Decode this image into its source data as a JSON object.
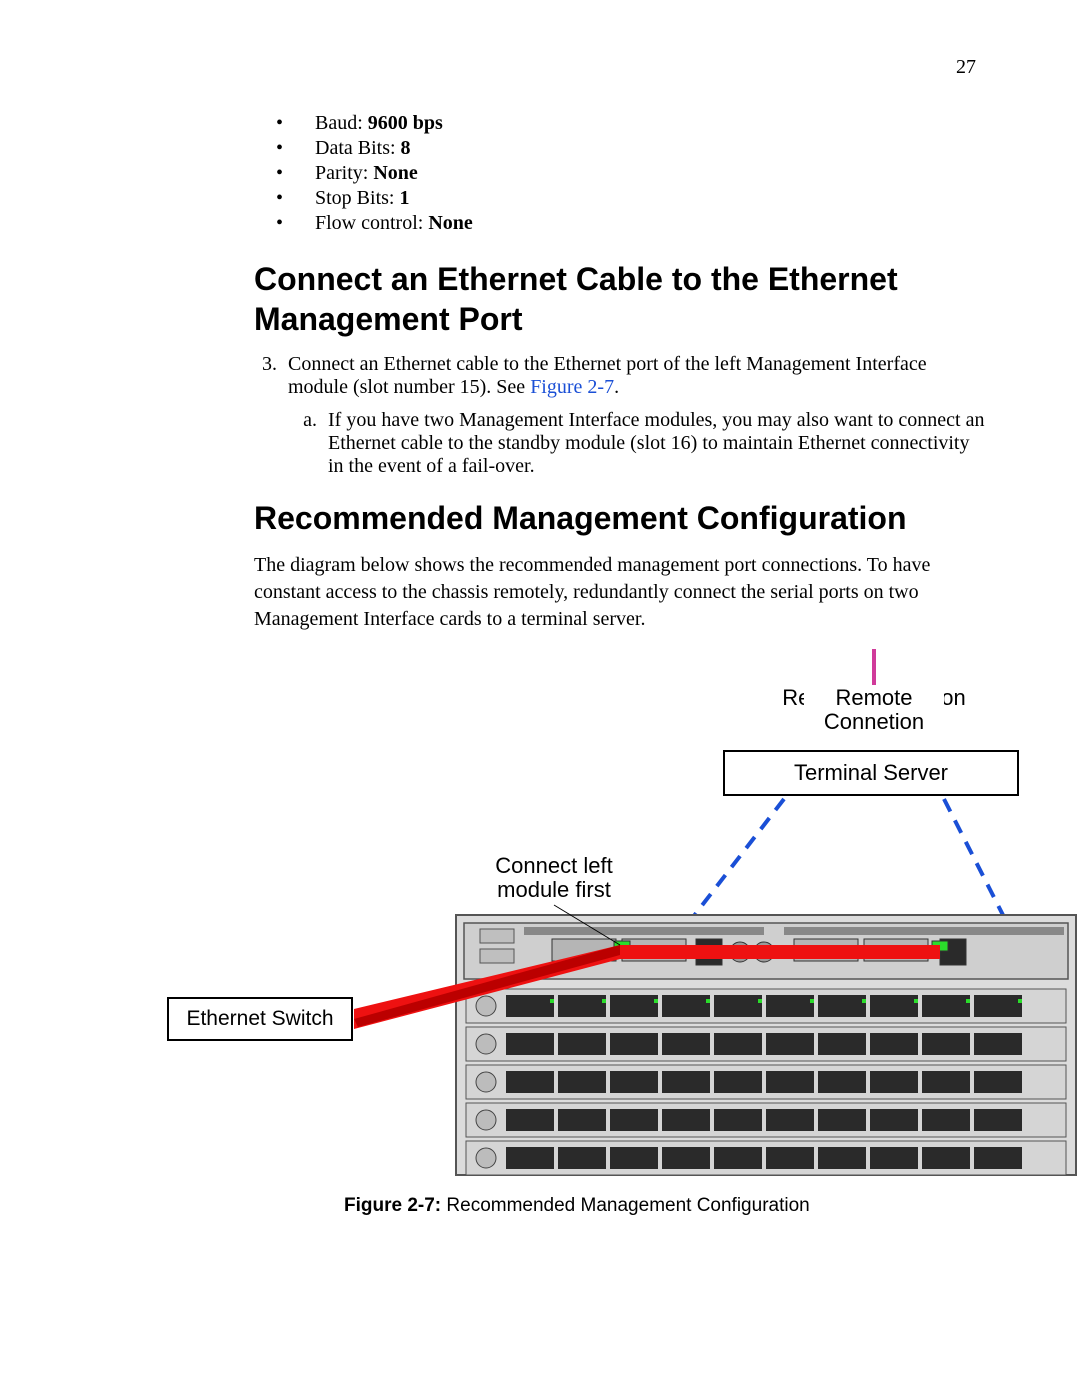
{
  "page_number": "27",
  "bullets": [
    {
      "label": "Baud: ",
      "value": "9600 bps"
    },
    {
      "label": "Data Bits: ",
      "value": "8"
    },
    {
      "label": "Parity: ",
      "value": "None"
    },
    {
      "label": "Stop Bits: ",
      "value": "1"
    },
    {
      "label": "Flow control: ",
      "value": "None"
    }
  ],
  "heading_ethernet": "Connect an Ethernet Cable to the Ethernet Management Port",
  "step3": {
    "number": "3",
    "text_before_link": "Connect an Ethernet cable to the Ethernet port of the left Management Interface module (slot number 15). See ",
    "link": "Figure 2-7",
    "text_after_link": ".",
    "sub_a": "If you have two Management Interface modules, you may also want to connect an Ethernet cable to the standby module (slot 16) to maintain Ethernet connectivity in the event of a fail-over."
  },
  "heading_recommended": "Recommended Management Configuration",
  "recommended_paragraph": "The diagram below shows the recommended management port connections. To have constant access to the chassis remotely, redundantly connect the serial ports on two Management Interface cards to a terminal server.",
  "figure": {
    "remote_connection": "Remote Connetion",
    "terminal_server": "Terminal Server",
    "connect_left_line1": "Connect left",
    "connect_left_line2": "module first",
    "ethernet_switch": "Ethernet Switch"
  },
  "figure_caption": {
    "label": "Figure 2-7:",
    "text": " Recommended Management Configuration"
  }
}
